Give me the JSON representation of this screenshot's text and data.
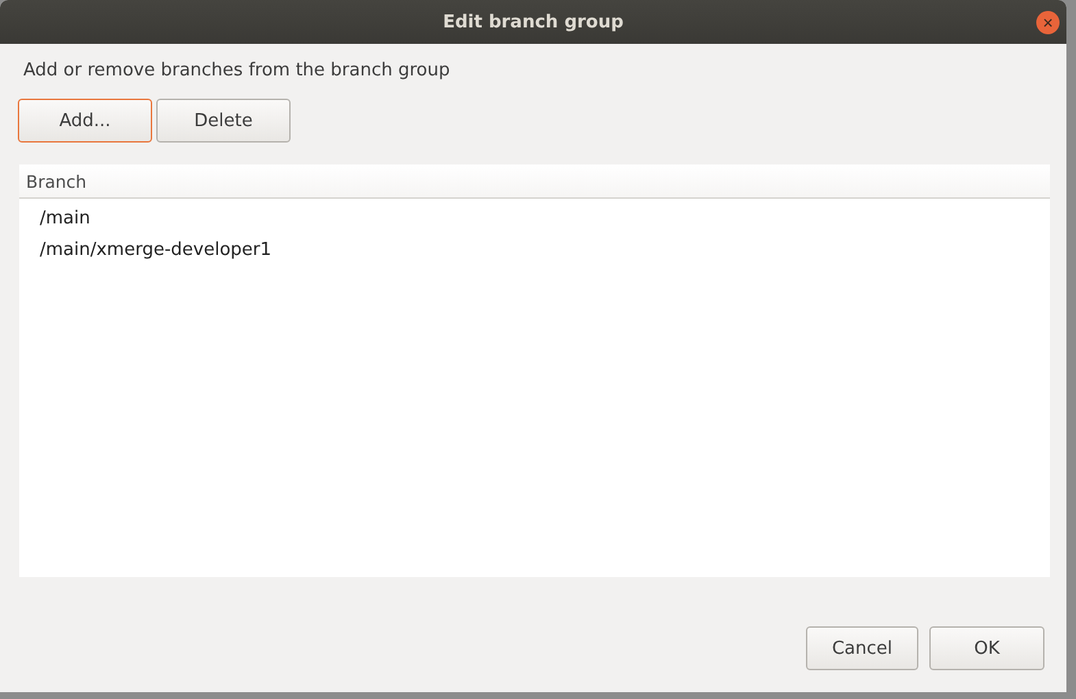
{
  "window": {
    "title": "Edit branch group",
    "close_icon": "×"
  },
  "description": "Add or remove branches from the branch group",
  "toolbar_buttons": [
    {
      "label": "Add...",
      "focused": true
    },
    {
      "label": "Delete",
      "focused": false
    }
  ],
  "table": {
    "columns": [
      "Branch"
    ],
    "rows": [
      {
        "cells": [
          "/main"
        ]
      },
      {
        "cells": [
          "/main/xmerge-developer1"
        ]
      }
    ]
  },
  "dialog_buttons": [
    {
      "label": "Cancel",
      "focused": false
    },
    {
      "label": "OK",
      "focused": false
    }
  ]
}
